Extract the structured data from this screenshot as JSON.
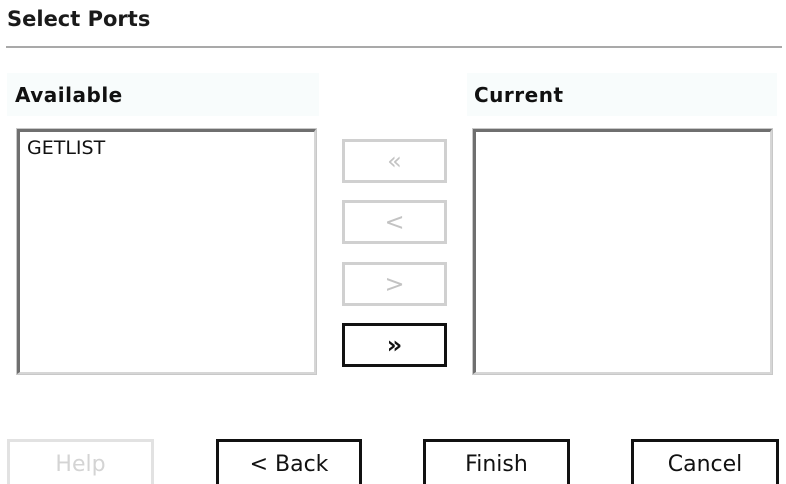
{
  "dialog": {
    "title": "Select Ports"
  },
  "available": {
    "header": "Available",
    "items": [
      "GETLIST"
    ]
  },
  "current": {
    "header": "Current",
    "items": []
  },
  "move_buttons": {
    "remove_all": {
      "label": "«",
      "enabled": false
    },
    "remove": {
      "label": "<",
      "enabled": false
    },
    "add": {
      "label": ">",
      "enabled": false
    },
    "add_all": {
      "label": "»",
      "enabled": true
    }
  },
  "footer": {
    "help": {
      "label": "Help",
      "enabled": false
    },
    "back": {
      "label": "< Back",
      "enabled": true
    },
    "finish": {
      "label": "Finish",
      "enabled": true
    },
    "cancel": {
      "label": "Cancel",
      "enabled": true
    }
  },
  "colors": {
    "header_bg": "#f8fcfc",
    "rule": "#a9a9a9",
    "disabled_text": "#c3c3c3",
    "enabled_border": "#111111"
  }
}
